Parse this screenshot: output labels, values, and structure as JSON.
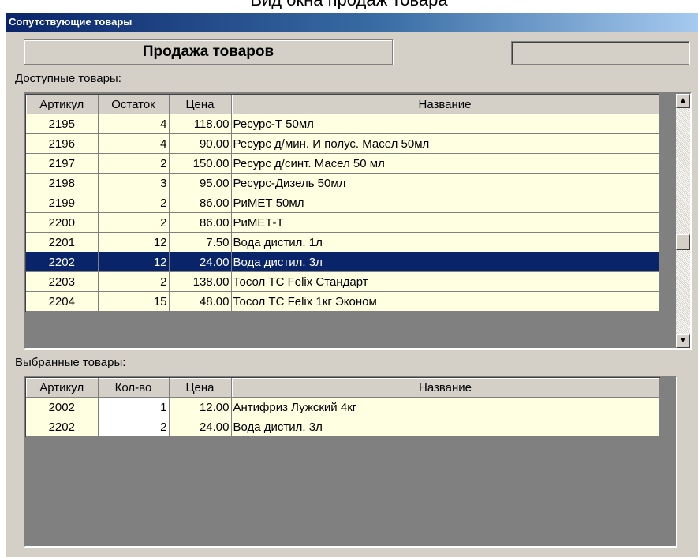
{
  "caption": "Вид окна продаж товара",
  "window": {
    "title": "Сопутствующие товары"
  },
  "header": {
    "title": "Продажа товаров",
    "info_value": ""
  },
  "available": {
    "label": "Доступные товары:",
    "columns": [
      "Артикул",
      "Остаток",
      "Цена",
      "Название"
    ],
    "rows": [
      {
        "sku": "2195",
        "stock": "4",
        "price": "118.00",
        "name": "Ресурс-Т 50мл"
      },
      {
        "sku": "2196",
        "stock": "4",
        "price": "90.00",
        "name": "Ресурс д/мин. И полус. Масел 50мл"
      },
      {
        "sku": "2197",
        "stock": "2",
        "price": "150.00",
        "name": "Ресурс д/синт. Масел 50 мл"
      },
      {
        "sku": "2198",
        "stock": "3",
        "price": "95.00",
        "name": "Ресурс-Дизель 50мл"
      },
      {
        "sku": "2199",
        "stock": "2",
        "price": "86.00",
        "name": "РиМЕТ 50мл"
      },
      {
        "sku": "2200",
        "stock": "2",
        "price": "86.00",
        "name": "РиМЕТ-Т"
      },
      {
        "sku": "2201",
        "stock": "12",
        "price": "7.50",
        "name": "Вода дистил. 1л"
      },
      {
        "sku": "2202",
        "stock": "12",
        "price": "24.00",
        "name": "Вода дистил. 3л"
      },
      {
        "sku": "2203",
        "stock": "2",
        "price": "138.00",
        "name": "Тосол ТС Felix Стандарт"
      },
      {
        "sku": "2204",
        "stock": "15",
        "price": "48.00",
        "name": "Тосол ТС Felix 1кг Эконом"
      }
    ],
    "selected_sku": "2202",
    "scroll_position": 0.6,
    "scroll_up_icon": "arrow-up-icon",
    "scroll_down_icon": "arrow-down-icon"
  },
  "selected": {
    "label": "Выбранные товары:",
    "columns": [
      "Артикул",
      "Кол-во",
      "Цена",
      "Название"
    ],
    "rows": [
      {
        "sku": "2002",
        "qty": "1",
        "price": "12.00",
        "name": "Антифриз Лужский 4кг"
      },
      {
        "sku": "2202",
        "qty": "2",
        "price": "24.00",
        "name": "Вода дистил. 3л"
      }
    ]
  }
}
